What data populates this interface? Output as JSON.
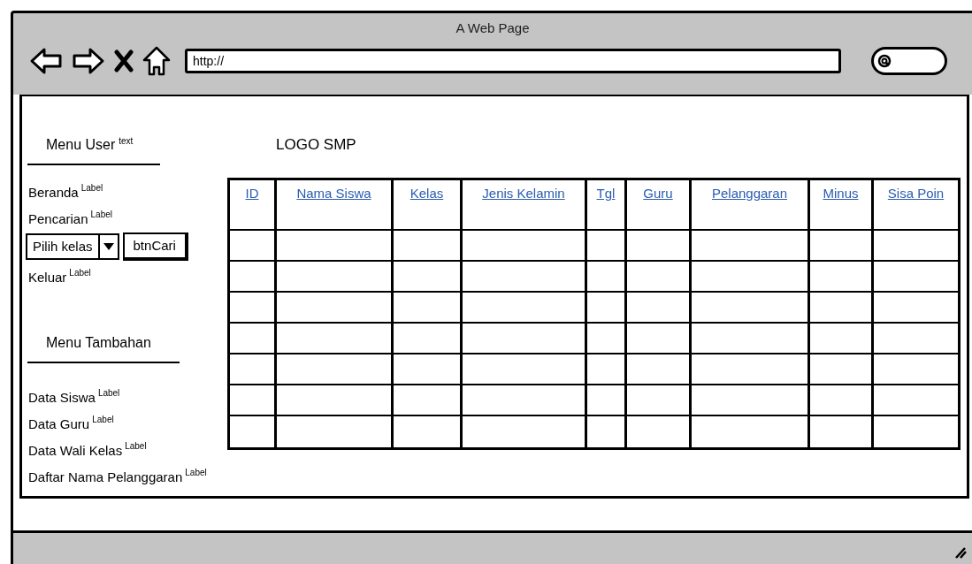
{
  "window": {
    "title": "A Web Page"
  },
  "browser": {
    "url": "http://"
  },
  "user_menu": {
    "heading": "Menu User",
    "heading_note": "text",
    "items": [
      {
        "kind": "label",
        "text": "Beranda",
        "note": "Label"
      },
      {
        "kind": "label",
        "text": "Pencarian",
        "note": "Label"
      },
      {
        "kind": "search",
        "select": "Pilih kelas",
        "button": "btnCari"
      },
      {
        "kind": "label",
        "text": "Keluar",
        "note": "Label"
      }
    ]
  },
  "extra_menu": {
    "heading": "Menu Tambahan",
    "items": [
      {
        "kind": "label",
        "text": "Data Siswa",
        "note": "Label"
      },
      {
        "kind": "label",
        "text": "Data Guru",
        "note": "Label"
      },
      {
        "kind": "label",
        "text": "Data Wali Kelas",
        "note": "Label"
      },
      {
        "kind": "label",
        "text": "Daftar Nama Pelanggaran",
        "note": "Label"
      }
    ]
  },
  "logo": "LOGO SMP",
  "table": {
    "columns": [
      "ID",
      "Nama Siswa",
      "Kelas",
      "Jenis Kelamin",
      "Tgl",
      "Guru",
      "Pelanggaran",
      "Minus",
      "Sisa Poin"
    ]
  }
}
